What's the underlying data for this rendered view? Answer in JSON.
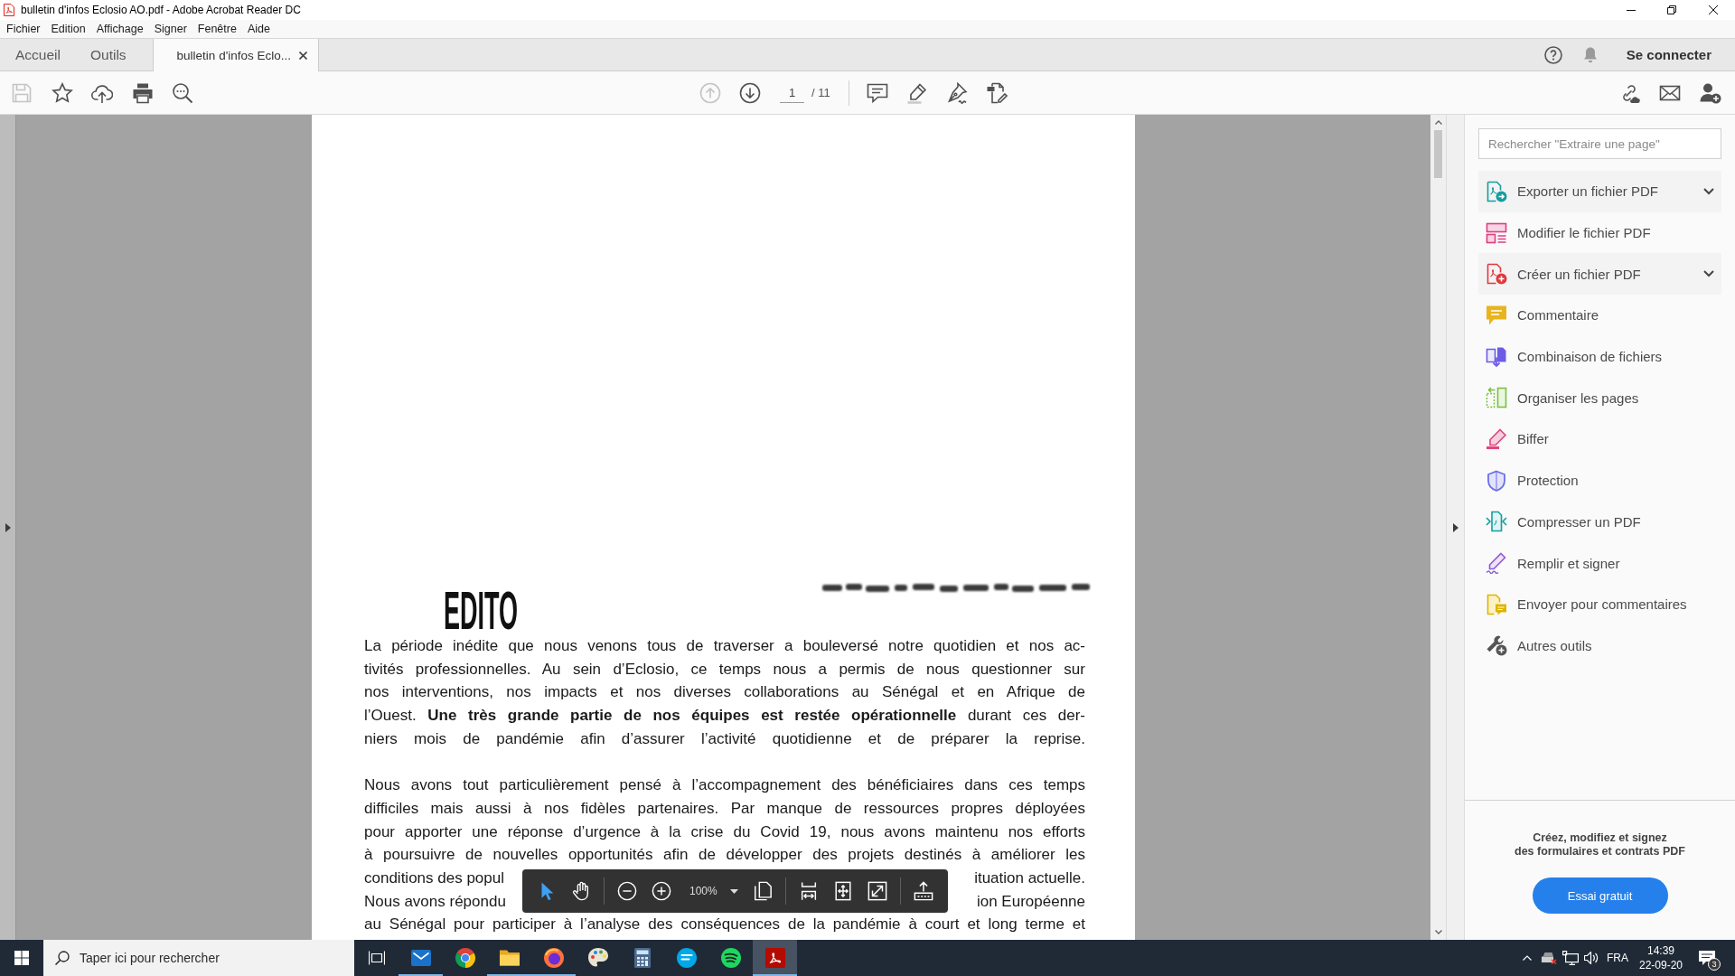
{
  "window": {
    "title": "bulletin d'infos Eclosio AO.pdf - Adobe Acrobat Reader DC"
  },
  "menu": [
    "Fichier",
    "Edition",
    "Affichage",
    "Signer",
    "Fenêtre",
    "Aide"
  ],
  "tabs": [
    {
      "label": "Accueil",
      "kind": "view",
      "selected": false
    },
    {
      "label": "Outils",
      "kind": "view",
      "selected": false
    },
    {
      "label": "bulletin d'infos Eclo...",
      "kind": "document",
      "selected": true
    }
  ],
  "account": {
    "sign_in": "Se connecter"
  },
  "toolbar": {
    "file_tools": [
      {
        "disabled": true
      },
      {
        "disabled": false
      },
      {
        "disabled": false
      },
      {
        "disabled": false
      },
      {
        "disabled": false
      }
    ],
    "page_nav": [
      {
        "disabled": true
      },
      {
        "disabled": false
      }
    ],
    "page": "1",
    "page_total": "/ 11"
  },
  "document": {
    "heading": "EDITO",
    "paragraphs": [
      {
        "lines": [
          {
            "kind": "full",
            "text": "La période inédite que nous venons tous de traverser a bouleversé notre quotidien et nos ac-"
          },
          {
            "kind": "full",
            "text": "tivités professionnelles. Au sein d’Eclosio, ce temps nous a permis de nous questionner sur"
          },
          {
            "kind": "full",
            "text": "nos interventions, nos impacts et nos diverses collaborations au Sénégal et en Afrique de"
          },
          {
            "kind": "full",
            "text": "l’Ouest. **Une très grande partie de nos équipes est restée opérationnelle** durant ces der-"
          },
          {
            "kind": "full",
            "text": "niers mois de pandémie afin d’assurer l’activité quotidienne et de préparer la reprise."
          }
        ]
      },
      {
        "lines": [
          {
            "kind": "full",
            "text": "Nous avons tout particulièrement pensé à l’accompagnement des bénéficiaires dans ces temps"
          },
          {
            "kind": "full",
            "text": "difficiles mais aussi à nos fidèles partenaires. Par manque de ressources propres déployées"
          },
          {
            "kind": "full",
            "text": "pour apporter une réponse d’urgence à la crise du Covid 19, nous avons maintenu nos efforts"
          },
          {
            "kind": "full",
            "text": "à poursuivre de nouvelles opportunités afin de développer des projets destinés à améliorer les"
          },
          {
            "kind": "covered",
            "fragments": [
              "conditions des popul",
              "ituation actuelle."
            ]
          },
          {
            "kind": "covered",
            "fragments": [
              "Nous avons répondu",
              "ion Européenne"
            ]
          },
          {
            "kind": "full",
            "text": "au Sénégal pour participer à l’analyse des conséquences de la pandémie à court et long terme et"
          }
        ]
      }
    ]
  },
  "view_toolbar": {
    "tools": [
      {
        "selected": true
      },
      {
        "selected": false
      }
    ],
    "zoom": "100%"
  },
  "tools_panel": {
    "search": {
      "placeholder": "Rechercher \"Extraire une page\""
    },
    "tools": [
      {
        "label": "Exporter un fichier PDF",
        "kind": "group",
        "expanded": false
      },
      {
        "label": "Modifier le fichier PDF",
        "kind": "tool"
      },
      {
        "label": "Créer un fichier PDF",
        "kind": "group",
        "expanded": false
      },
      {
        "label": "Commentaire",
        "kind": "tool"
      },
      {
        "label": "Combinaison de fichiers",
        "kind": "tool"
      },
      {
        "label": "Organiser les pages",
        "kind": "tool"
      },
      {
        "label": "Biffer",
        "kind": "tool"
      },
      {
        "label": "Protection",
        "kind": "tool"
      },
      {
        "label": "Compresser un PDF",
        "kind": "tool"
      },
      {
        "label": "Remplir et signer",
        "kind": "tool"
      },
      {
        "label": "Envoyer pour commentaires",
        "kind": "tool"
      },
      {
        "label": "Autres outils",
        "kind": "tool"
      }
    ],
    "promo": {
      "lines": [
        "Créez, modifiez et signez",
        "des formulaires et contrats PDF"
      ]
    },
    "button": "Essai gratuit"
  },
  "taskbar": {
    "search": {
      "placeholder": "Taper ici pour rechercher"
    },
    "apps": [
      {
        "running": true,
        "selected": false
      },
      {
        "running": false,
        "selected": false
      },
      {
        "running": true,
        "selected": false
      },
      {
        "running": true,
        "selected": false
      },
      {
        "running": false,
        "selected": false
      },
      {
        "running": false,
        "selected": false
      },
      {
        "running": false,
        "selected": false
      },
      {
        "running": false,
        "selected": false
      },
      {
        "running": true,
        "selected": true
      }
    ],
    "language": "FRA",
    "time": "14:39",
    "date": "22-09-20",
    "notifications": "3"
  }
}
